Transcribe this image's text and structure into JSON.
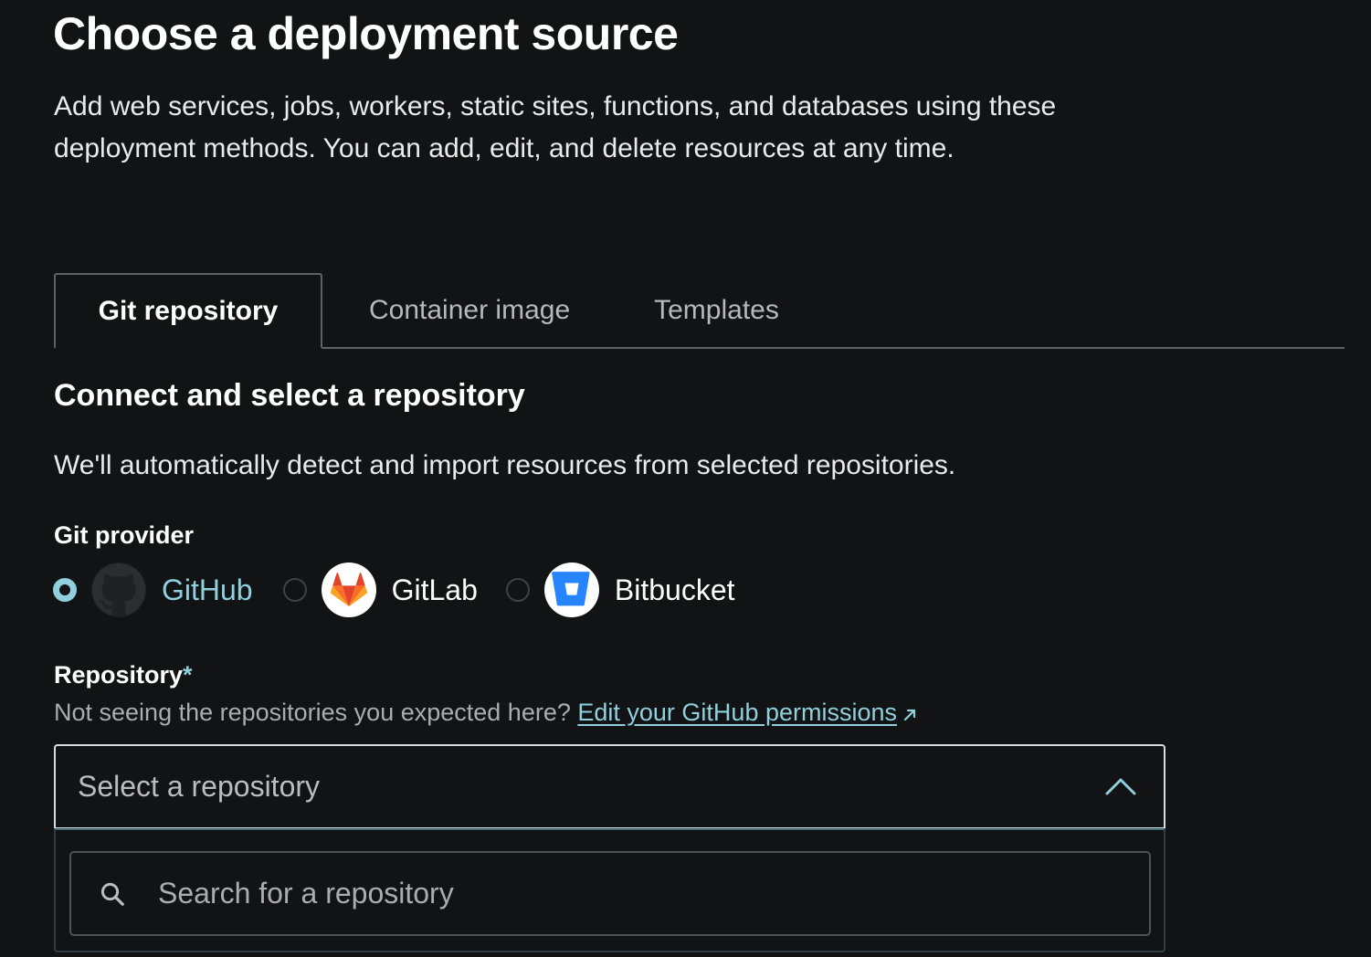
{
  "header": {
    "title": "Choose a deployment source",
    "description": "Add web services, jobs, workers, static sites, functions, and databases using these deployment methods. You can add, edit, and delete resources at any time."
  },
  "tabs": [
    {
      "label": "Git repository",
      "active": true
    },
    {
      "label": "Container image",
      "active": false
    },
    {
      "label": "Templates",
      "active": false
    }
  ],
  "section": {
    "title": "Connect and select a repository",
    "description": "We'll automatically detect and import resources from selected repositories."
  },
  "git_provider": {
    "label": "Git provider",
    "selected": "GitHub",
    "options": [
      {
        "label": "GitHub",
        "icon": "github-icon"
      },
      {
        "label": "GitLab",
        "icon": "gitlab-icon"
      },
      {
        "label": "Bitbucket",
        "icon": "bitbucket-icon"
      }
    ]
  },
  "repository": {
    "label": "Repository",
    "required_mark": "*",
    "help_text": "Not seeing the repositories you expected here?",
    "help_link": "Edit your GitHub permissions",
    "select_placeholder": "Select a repository",
    "search_placeholder": "Search for a repository"
  },
  "colors": {
    "background": "#111315",
    "accent": "#8fd0dc",
    "gitlab_orange": "#fc6d26",
    "bitbucket_blue": "#2684ff"
  }
}
